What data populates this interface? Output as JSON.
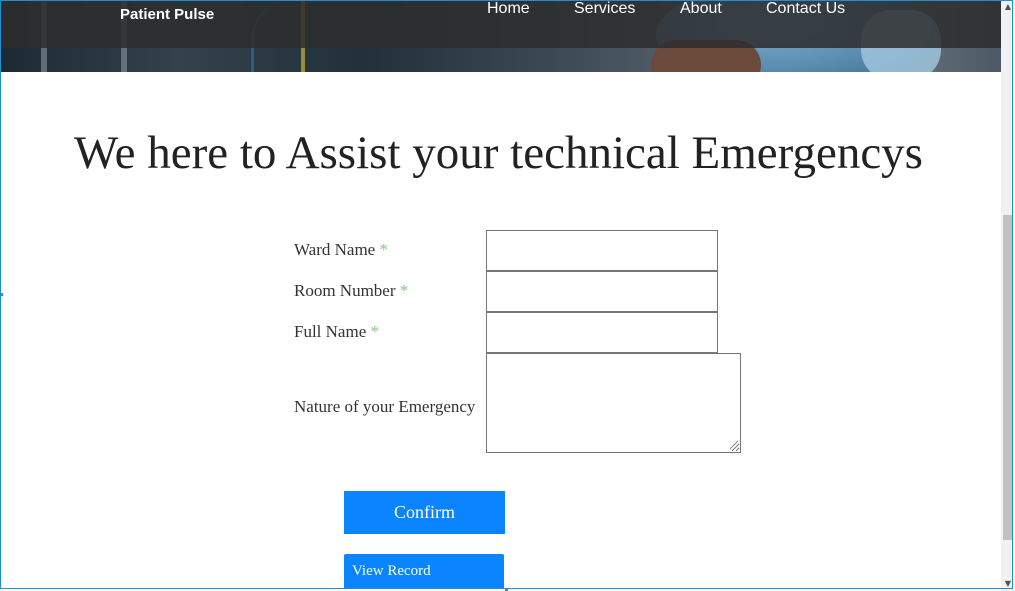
{
  "header": {
    "brand": "Patient Pulse",
    "nav": [
      "Home",
      "Services",
      "About",
      "Contact Us"
    ]
  },
  "main": {
    "title": "We here to Assist your technical Emergencys",
    "form": {
      "required_mark": "*",
      "ward_name_label": "Ward Name",
      "room_number_label": "Room Number",
      "full_name_label": "Full Name",
      "emergency_label": "Nature of your Emergency",
      "ward_name_value": "",
      "room_number_value": "",
      "full_name_value": "",
      "emergency_value": "",
      "confirm_label": "Confirm",
      "view_record_label": "View Record"
    }
  },
  "colors": {
    "accent": "#0a84ff",
    "required": "#8bc48a",
    "frame": "#1e90d6"
  },
  "scrollbar": {
    "up_icon": "chevron-up-icon",
    "down_icon": "chevron-down-icon"
  }
}
